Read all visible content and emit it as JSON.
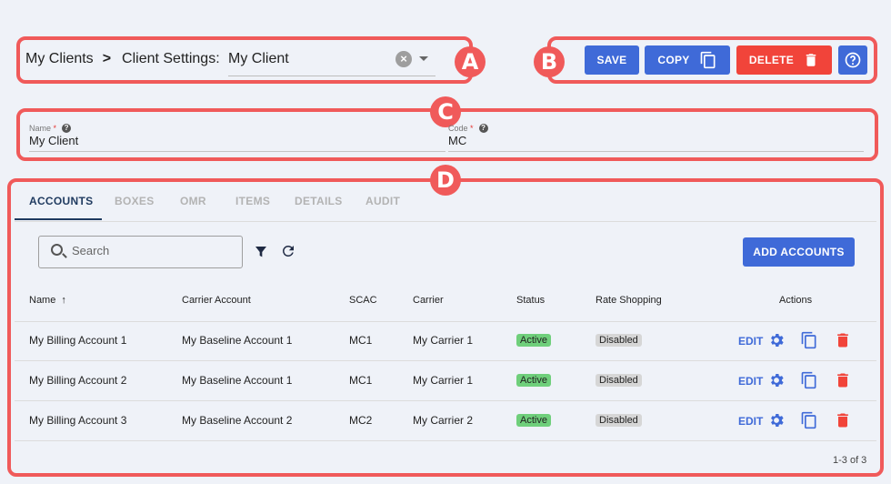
{
  "badges": {
    "a": "A",
    "b": "B",
    "c": "C",
    "d": "D"
  },
  "breadcrumb": {
    "root": "My Clients",
    "separator": ">",
    "current": "Client Settings:"
  },
  "client_select": {
    "value": "My Client"
  },
  "toolbar": {
    "save": "SAVE",
    "copy": "COPY",
    "delete": "DELETE",
    "help_icon": "help-circle-icon"
  },
  "form": {
    "name_label": "Name",
    "name_value": "My Client",
    "code_label": "Code",
    "code_value": "MC",
    "required_mark": "*"
  },
  "tabs": [
    "ACCOUNTS",
    "BOXES",
    "OMR",
    "ITEMS",
    "DETAILS",
    "AUDIT"
  ],
  "active_tab": "ACCOUNTS",
  "search": {
    "placeholder": "Search"
  },
  "add_button": "ADD ACCOUNTS",
  "table": {
    "columns": [
      "Name",
      "Carrier Account",
      "SCAC",
      "Carrier",
      "Status",
      "Rate Shopping",
      "Actions"
    ],
    "sort_indicator": "↑",
    "rows": [
      {
        "name": "My Billing Account 1",
        "carrier_account": "My Baseline Account 1",
        "scac": "MC1",
        "carrier": "My Carrier 1",
        "status": "Active",
        "rate_shopping": "Disabled",
        "edit": "EDIT"
      },
      {
        "name": "My Billing Account 2",
        "carrier_account": "My Baseline Account 1",
        "scac": "MC1",
        "carrier": "My Carrier 1",
        "status": "Active",
        "rate_shopping": "Disabled",
        "edit": "EDIT"
      },
      {
        "name": "My Billing Account 3",
        "carrier_account": "My Baseline Account 2",
        "scac": "MC2",
        "carrier": "My Carrier 2",
        "status": "Active",
        "rate_shopping": "Disabled",
        "edit": "EDIT"
      }
    ],
    "pagination": "1-3 of 3"
  },
  "colors": {
    "callout": "#f05a5a",
    "primary": "#3f6ad8",
    "danger": "#f1443a",
    "active": "#6fcf7b",
    "disabled": "#d6d6d6",
    "tab_active": "#1f3a5f"
  }
}
